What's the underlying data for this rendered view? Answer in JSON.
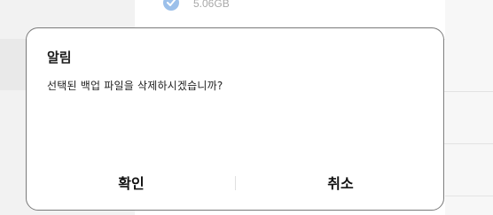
{
  "background": {
    "item_size": "5.06GB"
  },
  "dialog": {
    "title": "알림",
    "message": "선택된 백업 파일을 삭제하시겠습니까?",
    "confirm_label": "확인",
    "cancel_label": "취소"
  },
  "colors": {
    "dialog_border": "#7a7a7a",
    "icon_accent": "#9cc0ea"
  }
}
